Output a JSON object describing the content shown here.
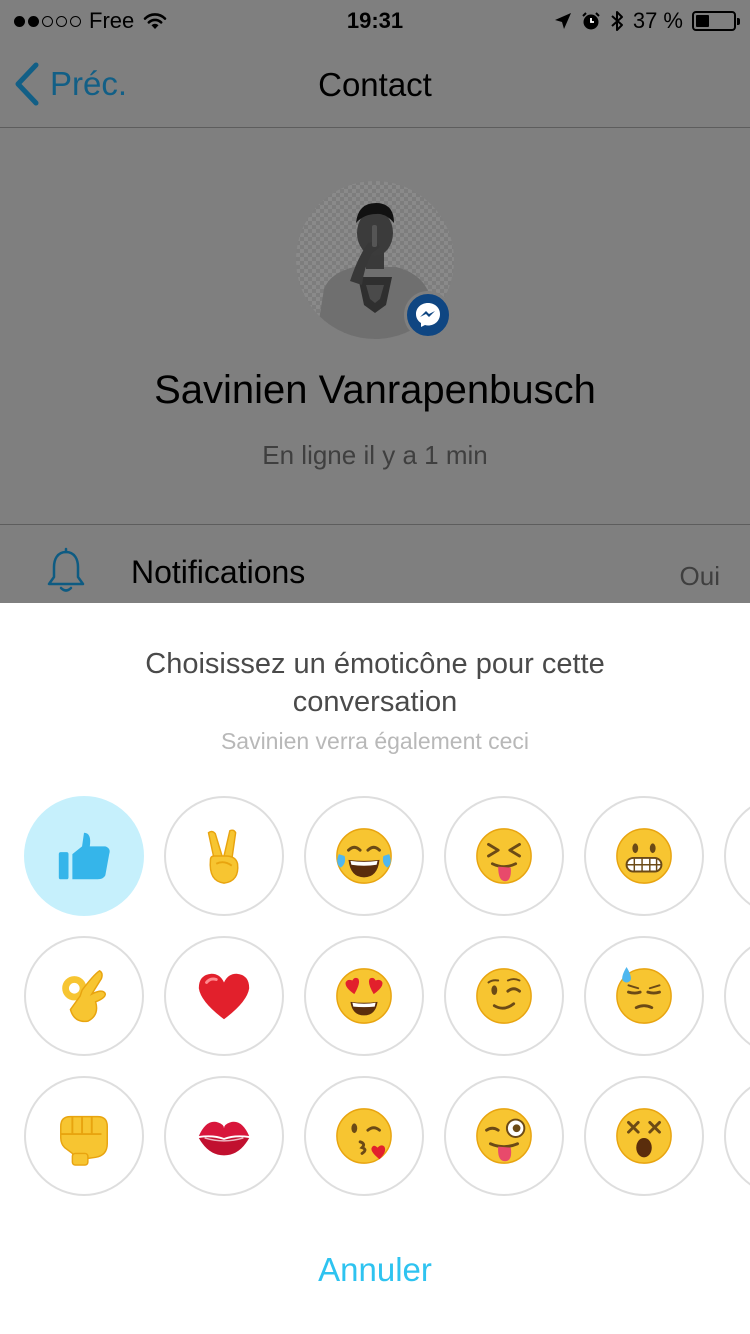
{
  "status_bar": {
    "signal_dots_filled": 2,
    "signal_dots_total": 5,
    "carrier": "Free",
    "time": "19:31",
    "battery_text": "37 %",
    "battery_level": 0.37,
    "icons": [
      "wifi-icon",
      "location-icon",
      "alarm-icon",
      "bluetooth-icon",
      "battery-icon"
    ]
  },
  "nav": {
    "back_label": "Préc.",
    "title": "Contact"
  },
  "profile": {
    "name": "Savinien Vanrapenbusch",
    "status": "En ligne il y a 1 min",
    "badge_icon": "messenger-icon"
  },
  "notifications": {
    "label": "Notifications",
    "value": "Oui",
    "icon": "bell-icon"
  },
  "sheet": {
    "title_line1": "Choisissez un émoticône pour cette",
    "title_line2": "conversation",
    "subtitle": "Savinien verra également ceci",
    "cancel_label": "Annuler",
    "selected_index": 0,
    "emojis": [
      [
        "thumbs-up",
        "victory-hand",
        "tears-of-joy",
        "squinting-tongue",
        "grimacing",
        "partial"
      ],
      [
        "ok-hand",
        "red-heart",
        "heart-eyes",
        "winking",
        "downcast-sweat",
        "partial"
      ],
      [
        "oncoming-fist",
        "kiss-mark",
        "face-blowing-kiss",
        "winking-tongue",
        "astonished",
        "partial"
      ]
    ]
  },
  "colors": {
    "overlay": "#7f7f7f",
    "accent": "#2ec3f0",
    "back_link": "#125f86",
    "selected_bg": "#c6f0fc",
    "thumbs_up": "#35b5ea"
  }
}
